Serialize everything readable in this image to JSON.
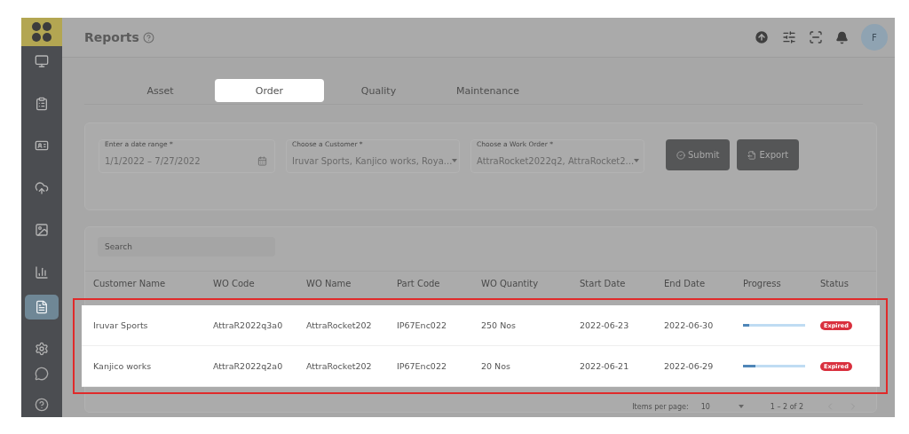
{
  "header": {
    "title": "Reports",
    "avatar_initial": "F"
  },
  "sidebar": {
    "items": [
      {
        "selected": false
      },
      {
        "selected": false
      },
      {
        "selected": false
      },
      {
        "selected": false
      },
      {
        "selected": false
      },
      {
        "selected": false
      },
      {
        "selected": true
      },
      {
        "selected": false
      }
    ]
  },
  "tabs": [
    {
      "label": "Asset",
      "selected": false
    },
    {
      "label": "Order",
      "selected": true
    },
    {
      "label": "Quality",
      "selected": false
    },
    {
      "label": "Maintenance",
      "selected": false
    }
  ],
  "filters": [
    {
      "label": "Enter a date range *",
      "value": "1/1/2022 – 7/27/2022",
      "kind": "date"
    },
    {
      "label": "Choose a Customer *",
      "value": "Iruvar Sports, Kanjico works, Roya...",
      "kind": "select"
    },
    {
      "label": "Choose a Work Order *",
      "value": "AttraRocket2022q2, AttraRocket2...",
      "kind": "select"
    }
  ],
  "buttons": [
    {
      "label": "Submit",
      "kind": "submit"
    },
    {
      "label": "Export",
      "kind": "export"
    }
  ],
  "search": {
    "placeholder": "Search"
  },
  "table": {
    "columns": [
      "Customer Name",
      "WO Code",
      "WO Name",
      "Part Code",
      "WO Quantity",
      "Start Date",
      "End Date",
      "Progress",
      "Status"
    ],
    "rows": [
      {
        "cells": [
          "Iruvar Sports",
          "AttraR2022q3a0",
          "AttraRocket202",
          "IP67Enc022",
          "250 Nos",
          "2022-06-23",
          "2022-06-30"
        ],
        "level": 0.1,
        "status": "Expired"
      },
      {
        "cells": [
          "Kanjico works",
          "AttraR2022q2a0",
          "AttraRocket202",
          "IP67Enc022",
          "20 Nos",
          "2022-06-21",
          "2022-06-29"
        ],
        "level": 0.2,
        "status": "Expired"
      }
    ]
  },
  "pagination": {
    "label": "Items per page:",
    "page_size": "10",
    "range": "1 – 2 of 2"
  }
}
